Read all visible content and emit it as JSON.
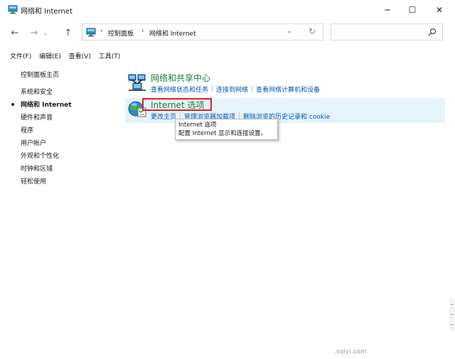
{
  "window": {
    "title": "网络和 Internet",
    "controls": {
      "minimize": "─",
      "maximize": "☐",
      "close": "✕"
    }
  },
  "navigation": {
    "back": "←",
    "forward": "→",
    "recent": "⌄",
    "up": "↑"
  },
  "address": {
    "breadcrumbs": [
      "控制面板",
      "网络和 Internet"
    ],
    "separator": "›",
    "dropdown": "⌄",
    "refresh": "↻"
  },
  "search": {
    "placeholder": ""
  },
  "menubar": {
    "items": [
      "文件(F)",
      "编辑(E)",
      "查看(V)",
      "工具(T)"
    ]
  },
  "leftnav": {
    "home": "控制面板主页",
    "items": [
      "系统和安全",
      "网络和 Internet",
      "硬件和声音",
      "程序",
      "用户帐户",
      "外观和个性化",
      "时钟和区域",
      "轻松使用"
    ],
    "current_index": 1
  },
  "categories": [
    {
      "title": "网络和共享中心",
      "icon": "network-sharing-icon",
      "links": [
        "查看网络状态和任务",
        "连接到网络",
        "查看网络计算机和设备"
      ]
    },
    {
      "title": "Internet 选项",
      "icon": "internet-options-icon",
      "links": [
        "更改主页",
        "管理浏览器加载项",
        "删除浏览的历史记录和 cookie"
      ]
    }
  ],
  "tooltip": {
    "line1": "Internet 选项",
    "line2": "配置 Internet 显示和连接设置。"
  },
  "watermark": {
    "text": ".sqiyi.com"
  },
  "colors": {
    "link": "#0058b8",
    "category_title": "#1e7b34",
    "highlight": "#e02020",
    "hover_bg": "#e5f3fb"
  }
}
